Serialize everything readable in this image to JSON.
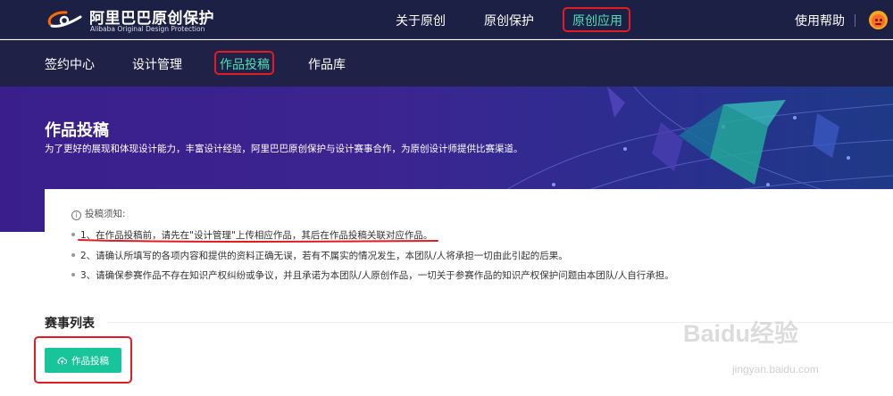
{
  "header": {
    "brand_title": "阿里巴巴原创保护",
    "brand_subtitle": "Alibaba Original Design Protection",
    "nav": [
      {
        "label": "关于原创"
      },
      {
        "label": "原创保护"
      },
      {
        "label": "原创应用",
        "active": true
      }
    ],
    "help_label": "使用帮助",
    "avatar_icon": "avatar-icon"
  },
  "subnav": {
    "items": [
      {
        "label": "签约中心"
      },
      {
        "label": "设计管理"
      },
      {
        "label": "作品投稿",
        "active": true
      },
      {
        "label": "作品库"
      }
    ]
  },
  "banner": {
    "title": "作品投稿",
    "description": "为了更好的展现和体现设计能力，丰富设计经验，阿里巴巴原创保护与设计赛事合作，为原创设计师提供比赛渠道。"
  },
  "notice": {
    "heading": "投稿须知:",
    "items": [
      "1、在作品投稿前，请先在\"设计管理\"上传相应作品，其后在作品投稿关联对应作品。",
      "2、请确认所填写的各项内容和提供的资料正确无误，若有不属实的情况发生，本团队/人将承担一切由此引起的后果。",
      "3、请确保参赛作品不存在知识产权纠纷或争议，并且承诺为本团队/人原创作品，一切关于参赛作品的知识产权保护问题由本团队/人自行承担。"
    ]
  },
  "events": {
    "section_title": "赛事列表",
    "submit_button": "作品投稿",
    "submit_icon": "cloud-upload-icon"
  },
  "watermark": {
    "text": "Baidu经验",
    "url": "jingyan.baidu.com"
  },
  "colors": {
    "header_bg": "#1d2045",
    "accent": "#4de0b4",
    "button": "#18c59b",
    "annotation": "#e51b23",
    "banner_start": "#3a1f8c",
    "banner_end": "#1e3a86"
  }
}
